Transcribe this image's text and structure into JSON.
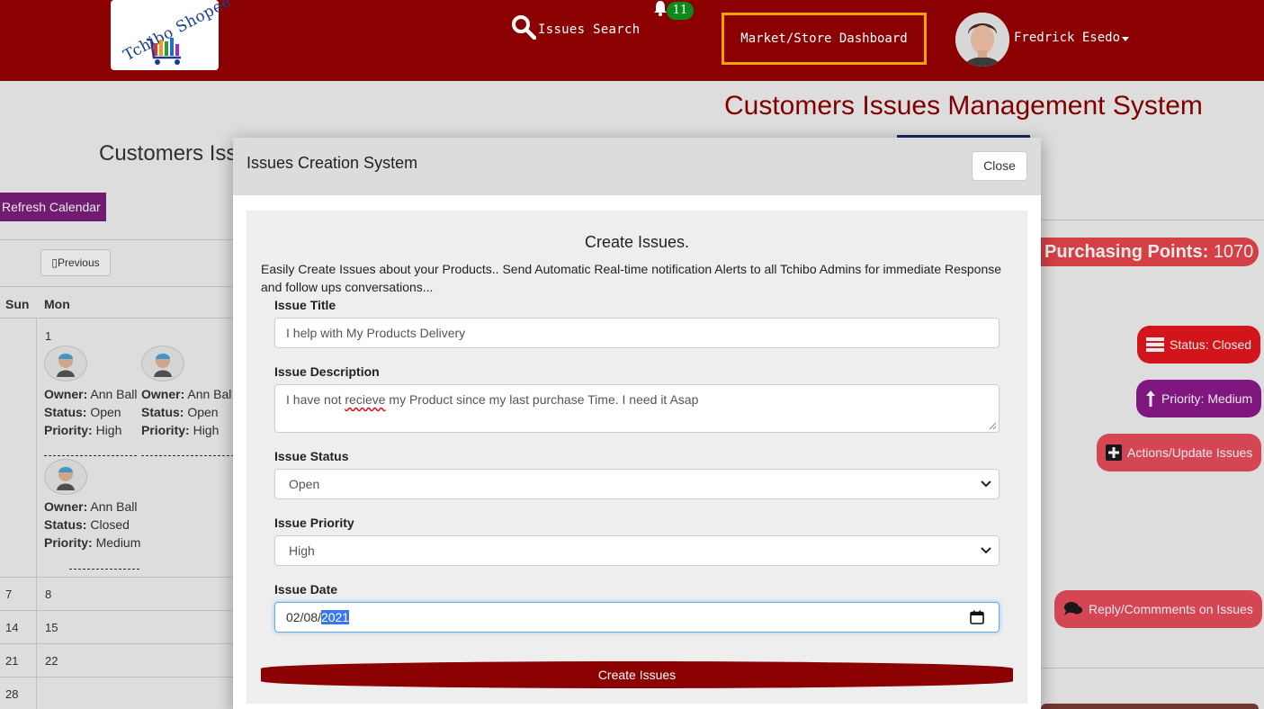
{
  "header": {
    "logo_text": "Tchibo Shopee",
    "search_label": "Issues Search",
    "notification_count": "11",
    "dashboard_label": "Market/Store Dashboard",
    "user_name": "Fredrick Esedo",
    "brand_color": "#8b0000",
    "accent_border_color": "#f0a500",
    "badge_color": "#0d8a1c"
  },
  "background_page": {
    "title": "Customers Issues Management System",
    "calendar_title": "Customers Iss",
    "refresh_label": "Refresh Calendar",
    "prev_label": "Previous",
    "weekdays": [
      "Sun",
      "Mon"
    ],
    "rows": [
      {
        "sun": "",
        "mon": "1"
      },
      {
        "sun": "7",
        "mon": "8"
      },
      {
        "sun": "14",
        "mon": "15"
      },
      {
        "sun": "21",
        "mon": "22"
      },
      {
        "sun": "28",
        "mon": ""
      }
    ],
    "events": [
      {
        "owner_label": "Owner:",
        "owner": "Ann Ball",
        "status_label": "Status:",
        "status": "Open",
        "priority_label": "Priority:",
        "priority": "High"
      },
      {
        "owner_label": "Owner:",
        "owner": "Ann Bal",
        "status_label": "Status:",
        "status": "Open",
        "priority_label": "Priority:",
        "priority": "High"
      },
      {
        "owner_label": "Owner:",
        "owner": "Ann Ball",
        "status_label": "Status:",
        "status": "Closed",
        "priority_label": "Priority:",
        "priority": "Medium"
      }
    ],
    "points_label": "Purchasing Points:",
    "points_value": "1070",
    "status_pill": "Status: Closed",
    "priority_pill": "Priority: Medium",
    "actions_pill": "Actions/Update Issues",
    "reply_pill": "Reply/Commments on Issues"
  },
  "modal": {
    "title": "Issues Creation System",
    "close_label": "Close",
    "heading": "Create Issues.",
    "intro": "Easily Create Issues about your Products.. Send Automatic Real-time notification Alerts to all Tchibo Admins for immediate Response and follow ups conversations...",
    "fields": {
      "title_label": "Issue Title",
      "title_value": "I help with My Products Delivery",
      "description_label": "Issue Description",
      "description_before": "I have not ",
      "description_misspelled": "recieve",
      "description_after": " my Product since my last purchase Time. I need it Asap",
      "status_label": "Issue Status",
      "status_value": "Open",
      "priority_label": "Issue Priority",
      "priority_value": "High",
      "date_label": "Issue Date",
      "date_prefix": "02/08/",
      "date_selected": "2021"
    },
    "submit_label": "Create Issues"
  }
}
